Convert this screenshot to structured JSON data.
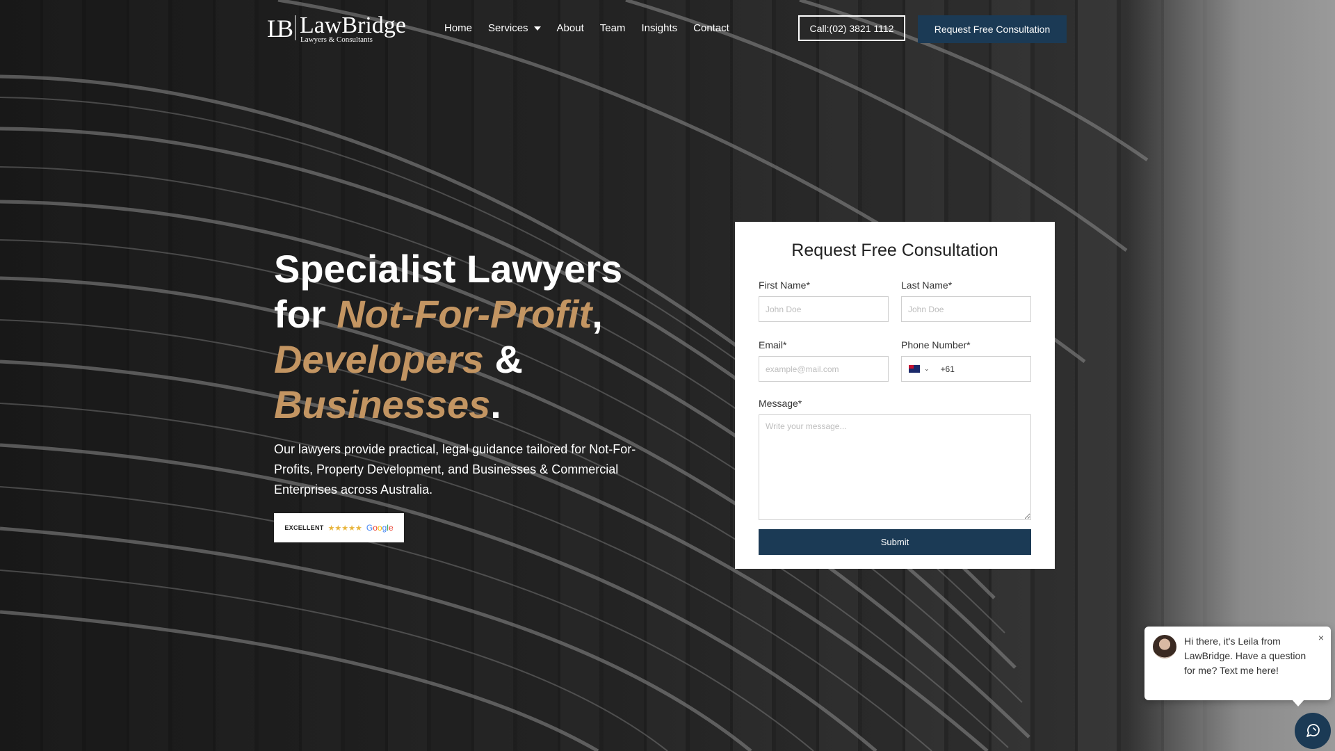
{
  "brand": {
    "mark": "LB",
    "name": "LawBridge",
    "tagline": "Lawyers & Consultants"
  },
  "nav": {
    "items": [
      {
        "label": "Home"
      },
      {
        "label": "Services"
      },
      {
        "label": "About"
      },
      {
        "label": "Team"
      },
      {
        "label": "Insights"
      },
      {
        "label": "Contact"
      }
    ]
  },
  "header": {
    "call_label": "Call:(02) 3821 1112",
    "cta_label": "Request Free Consultation"
  },
  "hero": {
    "title_line1": "Specialist Lawyers",
    "title_for": "for ",
    "highlight1": "Not-For-Profit",
    "comma": ",",
    "highlight2": "Developers",
    "amp": " &",
    "highlight3": "Businesses",
    "period": ".",
    "description": "Our lawyers provide practical, legal guidance tailored for Not-For-Profits, Property Development, and Businesses & Commercial Enterprises across Australia."
  },
  "badge": {
    "rating_text": "EXCELLENT",
    "stars": "★★★★★",
    "google": [
      "G",
      "o",
      "o",
      "g",
      "l",
      "e"
    ]
  },
  "form": {
    "title": "Request Free Consultation",
    "first_name_label": "First Name*",
    "first_name_placeholder": "John Doe",
    "last_name_label": "Last Name*",
    "last_name_placeholder": "John Doe",
    "email_label": "Email*",
    "email_placeholder": "example@mail.com",
    "phone_label": "Phone Number*",
    "phone_code": "+61",
    "message_label": "Message*",
    "message_placeholder": "Write your message...",
    "submit_label": "Submit"
  },
  "chat": {
    "message": "Hi there, it's Leila from LawBridge. Have a question for me? Text me here!",
    "close": "×"
  },
  "colors": {
    "accent_gold": "#c39562",
    "brand_navy": "#1b3a55"
  }
}
